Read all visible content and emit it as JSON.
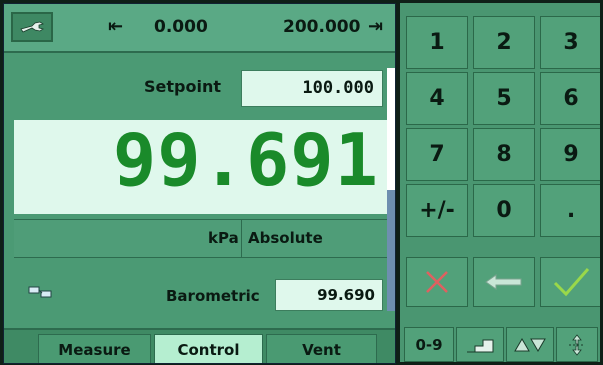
{
  "range": {
    "min": "0.000",
    "max": "200.000"
  },
  "setpoint": {
    "label": "Setpoint",
    "value": "100.000"
  },
  "reading": {
    "value": "99.691",
    "unit": "kPa",
    "mode": "Absolute"
  },
  "barometric": {
    "label": "Barometric",
    "value": "99.690"
  },
  "tabs": [
    {
      "label": "Measure",
      "active": false
    },
    {
      "label": "Control",
      "active": true
    },
    {
      "label": "Vent",
      "active": false
    }
  ],
  "keypad": {
    "keys": [
      "1",
      "2",
      "3",
      "4",
      "5",
      "6",
      "7",
      "8",
      "9",
      "+/-",
      "0",
      "."
    ],
    "cancel_icon": "x-icon",
    "backspace_icon": "left-arrow-icon",
    "enter_icon": "checkmark-icon"
  },
  "bottom_bar": {
    "numeric_label": "0-9"
  },
  "icons": {
    "settings": "wrench-icon",
    "range_min": "left-limit-arrow-icon",
    "range_max": "right-limit-arrow-icon",
    "barometric": "barometer-icon"
  },
  "colors": {
    "reading": "#1a8a2a",
    "panel": "#4b9a74",
    "highlight": "#dff8ec",
    "cancel": "#e06060",
    "enter": "#9ad84a"
  }
}
